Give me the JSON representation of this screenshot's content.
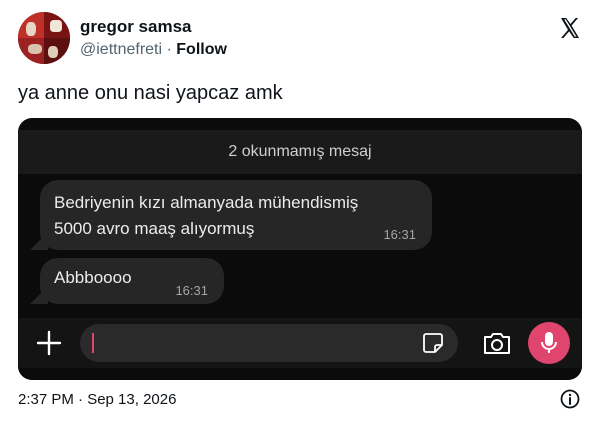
{
  "author": {
    "name": "gregor samsa",
    "handle": "@iettnefreti",
    "separator": " · ",
    "follow_label": "Follow"
  },
  "tweet": {
    "text": "ya anne onu nasi yapcaz amk",
    "timestamp": "2:37 PM · Sep 13, 2026"
  },
  "chat": {
    "unread_banner": "2 okunmamış mesaj",
    "messages": [
      {
        "line1": "Bedriyenin kızı almanyada mühendismiş",
        "line2": "5000 avro maaş alıyormuş",
        "time": "16:31"
      },
      {
        "text": "Abbboooo",
        "time": "16:31"
      }
    ]
  },
  "icons": {
    "logo": "x-logo-icon",
    "plus": "plus-icon",
    "sticker": "sticker-icon",
    "camera": "camera-icon",
    "mic": "microphone-icon",
    "info": "info-icon"
  },
  "colors": {
    "accent": "#e0456e",
    "chat_bg": "#0b0b0b",
    "bubble": "#262626"
  }
}
